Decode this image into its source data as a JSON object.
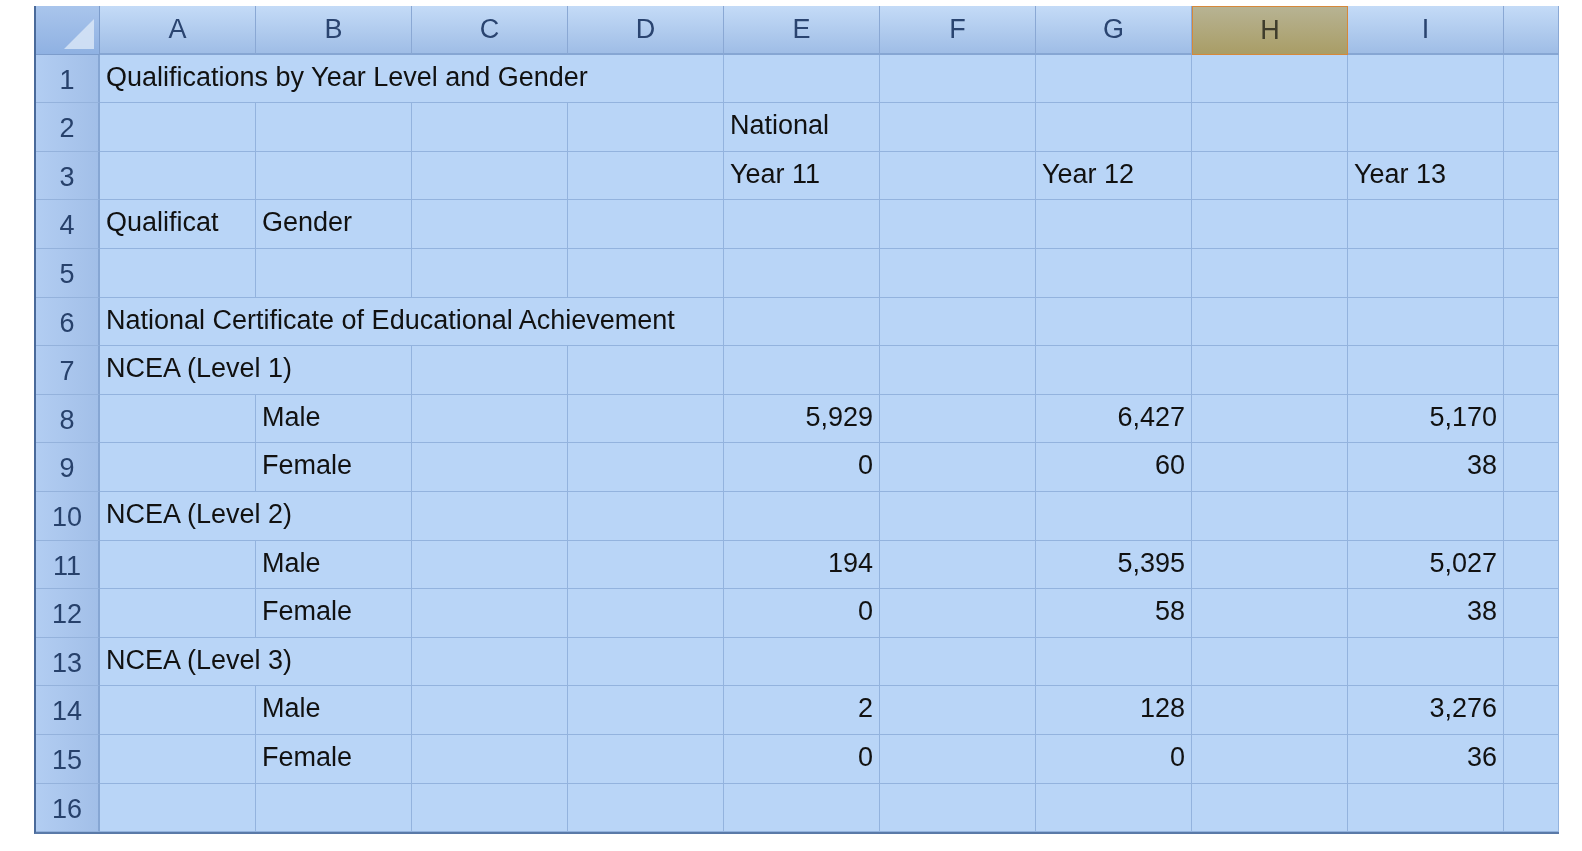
{
  "columns": [
    {
      "label": "A",
      "selected": false
    },
    {
      "label": "B",
      "selected": false
    },
    {
      "label": "C",
      "selected": false
    },
    {
      "label": "D",
      "selected": false
    },
    {
      "label": "E",
      "selected": false
    },
    {
      "label": "F",
      "selected": false
    },
    {
      "label": "G",
      "selected": false
    },
    {
      "label": "H",
      "selected": true
    },
    {
      "label": "I",
      "selected": false
    }
  ],
  "rows": [
    {
      "number": "1",
      "cells": {
        "a": {
          "text": "Qualifications by Year Level and Gender",
          "kind": "text"
        }
      }
    },
    {
      "number": "2",
      "cells": {
        "e": {
          "text": "National",
          "kind": "text"
        }
      }
    },
    {
      "number": "3",
      "cells": {
        "e": {
          "text": "Year 11",
          "kind": "text"
        },
        "g": {
          "text": "Year 12",
          "kind": "text"
        },
        "i": {
          "text": "Year 13",
          "kind": "text"
        }
      }
    },
    {
      "number": "4",
      "cells": {
        "a": {
          "text": "Qualificat",
          "kind": "text"
        },
        "b": {
          "text": "Gender",
          "kind": "text"
        }
      }
    },
    {
      "number": "5",
      "cells": {}
    },
    {
      "number": "6",
      "cells": {
        "a": {
          "text": "National Certificate of Educational Achievement",
          "kind": "text"
        }
      }
    },
    {
      "number": "7",
      "cells": {
        "a": {
          "text": "NCEA (Level 1)",
          "kind": "text"
        }
      }
    },
    {
      "number": "8",
      "cells": {
        "b": {
          "text": "Male",
          "kind": "text"
        },
        "e": {
          "text": "5,929",
          "kind": "number"
        },
        "g": {
          "text": "6,427",
          "kind": "number"
        },
        "i": {
          "text": "5,170",
          "kind": "number"
        }
      }
    },
    {
      "number": "9",
      "cells": {
        "b": {
          "text": "Female",
          "kind": "text"
        },
        "e": {
          "text": "0",
          "kind": "number"
        },
        "g": {
          "text": "60",
          "kind": "number"
        },
        "i": {
          "text": "38",
          "kind": "number"
        }
      }
    },
    {
      "number": "10",
      "cells": {
        "a": {
          "text": "NCEA (Level 2)",
          "kind": "text"
        }
      }
    },
    {
      "number": "11",
      "cells": {
        "b": {
          "text": "Male",
          "kind": "text"
        },
        "e": {
          "text": "194",
          "kind": "number"
        },
        "g": {
          "text": "5,395",
          "kind": "number"
        },
        "i": {
          "text": "5,027",
          "kind": "number"
        }
      }
    },
    {
      "number": "12",
      "cells": {
        "b": {
          "text": "Female",
          "kind": "text"
        },
        "e": {
          "text": "0",
          "kind": "number"
        },
        "g": {
          "text": "58",
          "kind": "number"
        },
        "i": {
          "text": "38",
          "kind": "number"
        }
      }
    },
    {
      "number": "13",
      "cells": {
        "a": {
          "text": "NCEA (Level 3)",
          "kind": "text"
        }
      }
    },
    {
      "number": "14",
      "cells": {
        "b": {
          "text": "Male",
          "kind": "text"
        },
        "e": {
          "text": "2",
          "kind": "number"
        },
        "g": {
          "text": "128",
          "kind": "number"
        },
        "i": {
          "text": "3,276",
          "kind": "number"
        }
      }
    },
    {
      "number": "15",
      "cells": {
        "b": {
          "text": "Female",
          "kind": "text"
        },
        "e": {
          "text": "0",
          "kind": "number"
        },
        "g": {
          "text": "0",
          "kind": "number"
        },
        "i": {
          "text": "36",
          "kind": "number"
        }
      }
    },
    {
      "number": "16",
      "cells": {}
    }
  ]
}
